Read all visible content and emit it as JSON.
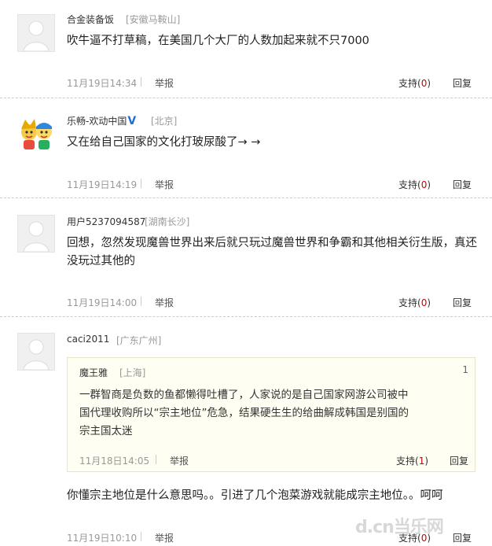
{
  "comments": [
    {
      "username": "合金装备饭",
      "location": "[安徽马鞍山]",
      "body": "吹牛逼不打草稿，在美国几个大厂的人数加起来就不只7000",
      "time": "11月19日14:34",
      "report": "举报",
      "support_label": "支持(",
      "support_count": "0",
      "support_close": ")",
      "reply": "回复"
    },
    {
      "username": "乐畅-欢动中国",
      "verified_badge": "V",
      "location": "[北京]",
      "body": "又在给自己国家的文化打玻尿酸了→ →",
      "time": "11月19日14:19",
      "report": "举报",
      "support_label": "支持(",
      "support_count": "0",
      "support_close": ")",
      "reply": "回复"
    },
    {
      "username": "用户5237094587",
      "location": "[湖南长沙]",
      "body": "回想，忽然发现魔兽世界出来后就只玩过魔兽世界和争霸和其他相关衍生版，真还没玩过其他的",
      "time": "11月19日14:00",
      "report": "举报",
      "support_label": "支持(",
      "support_count": "0",
      "support_close": ")",
      "reply": "回复"
    },
    {
      "username": "caci2011",
      "location": "[广东广州]",
      "quote": {
        "username": "魔王雅",
        "location": "[上海]",
        "floor": "1",
        "body": "一群智商是负数的鱼都懒得吐槽了，人家说的是自己国家网游公司被中国代理收购所以“宗主地位”危急，结果硬生生的给曲解成韩国是别国的宗主国太迷",
        "time": "11月18日14:05",
        "report": "举报",
        "support_label": "支持(",
        "support_count": "1",
        "support_close": ")",
        "reply": "回复"
      },
      "body": "你懂宗主地位是什么意思吗。。引进了几个泡菜游戏就能成宗主地位。。呵呵",
      "time": "11月19日10:10",
      "report": "举报",
      "support_label": "支持(",
      "support_count": "0",
      "support_close": ")",
      "reply": "回复"
    }
  ],
  "watermark": "d.cn当乐网",
  "colors": {
    "count_red": "#cc0000",
    "verified_blue": "#1e6fd0",
    "quote_bg": "#fffef2"
  }
}
